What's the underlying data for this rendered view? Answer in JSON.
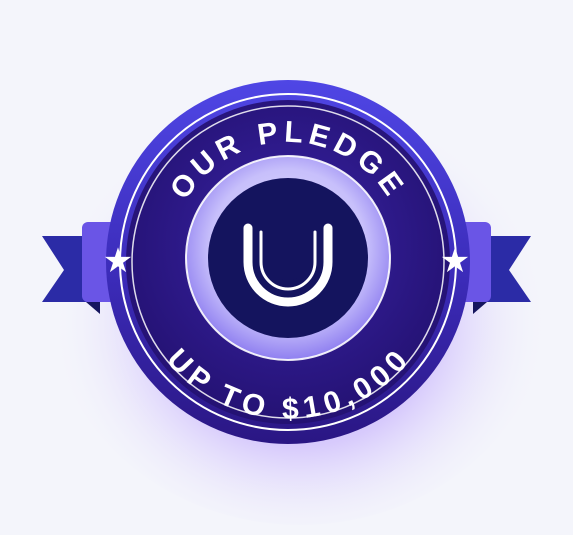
{
  "badge": {
    "top_text": "OUR PLEDGE",
    "bottom_text": "UP TO $10,000",
    "logo_letter": "U"
  },
  "icons": {
    "left_ribbon": "star-icon",
    "right_ribbon": "star-icon",
    "center": "u-logo-icon"
  },
  "colors": {
    "badge_outer": "#4b3fd6",
    "badge_inner": "#2a1a8a",
    "ribbon": "#2b2a9e",
    "ribbon_tab": "#6b54e8",
    "logo_bg": "#14145e",
    "glow": "#8a4dff"
  }
}
